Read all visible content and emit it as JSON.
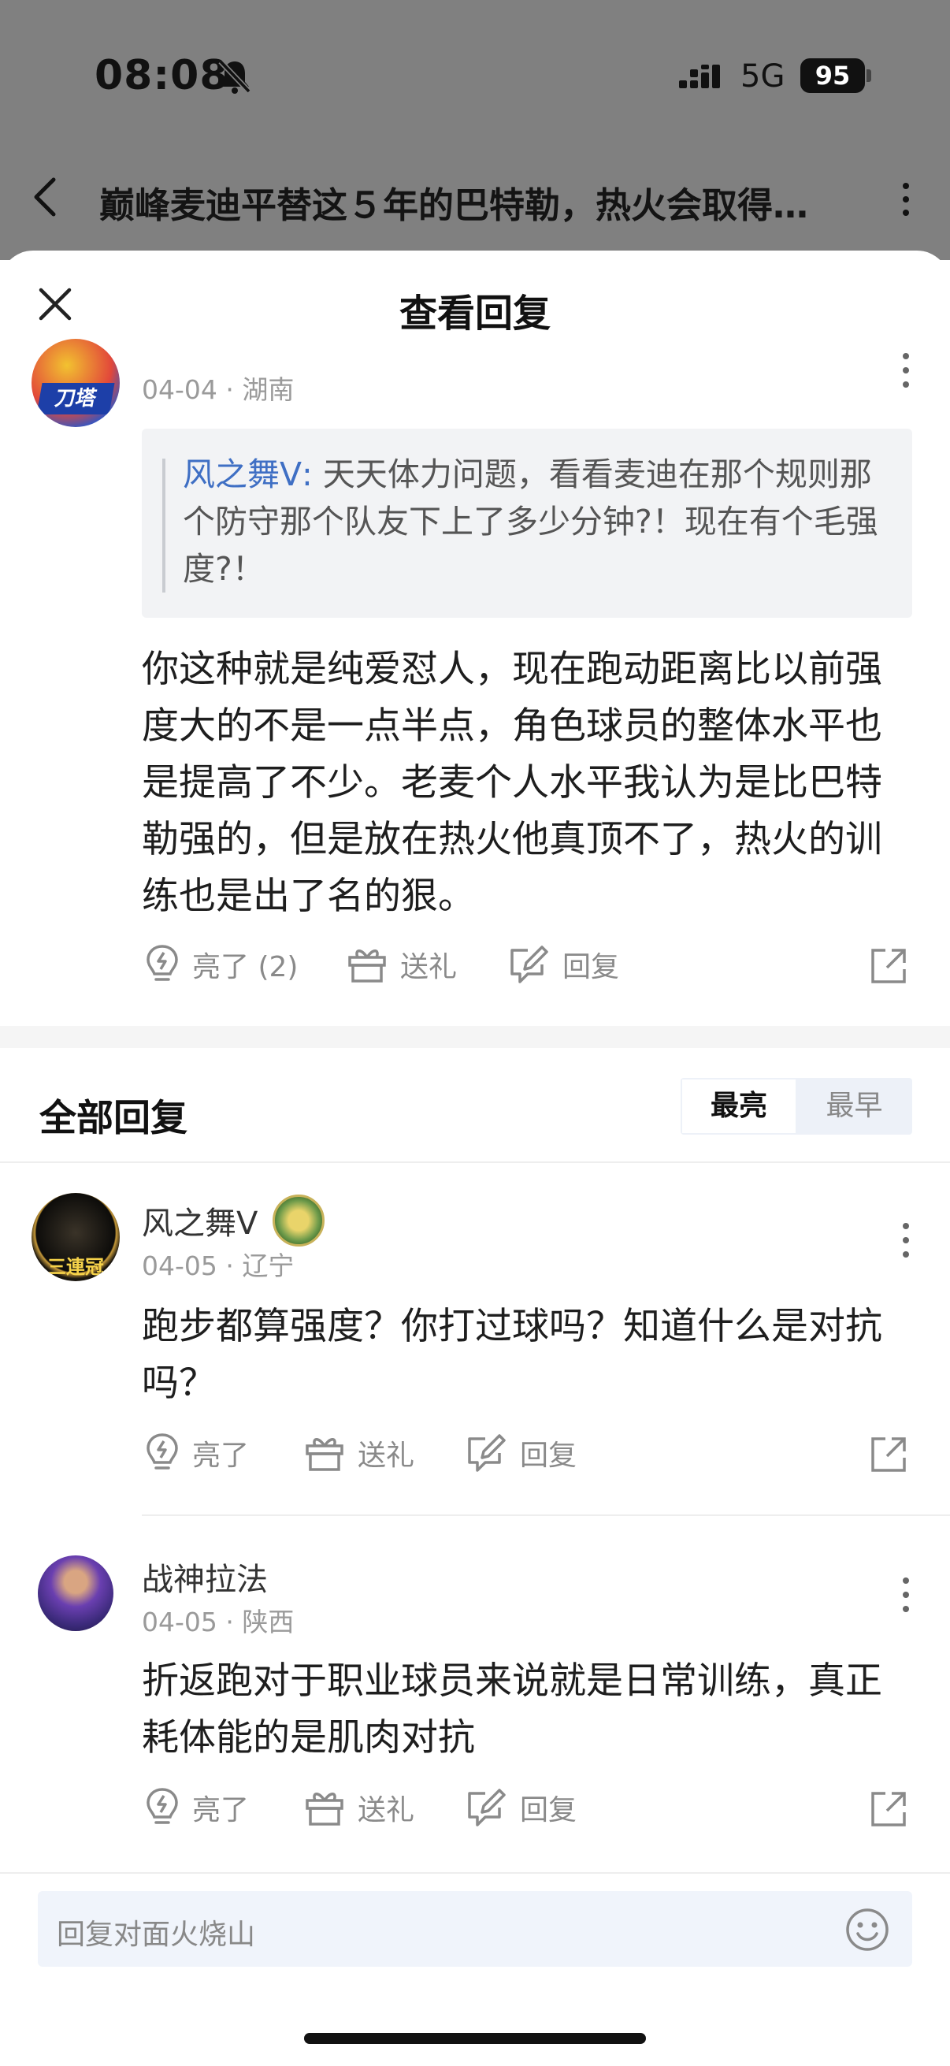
{
  "status_bar": {
    "time": "08:08",
    "network": "5G",
    "battery": "95"
  },
  "background_page": {
    "title": "巅峰麦迪平替这５年的巴特勒，热火会取得…"
  },
  "sheet": {
    "title": "查看回复"
  },
  "main_comment": {
    "date_location": "04-04 · 湖南",
    "quote_author": "风之舞Ⅴ:",
    "quote_text": " 天天体力问题，看看麦迪在那个规则那个防守那个队友下上了多少分钟?！现在有个毛强度?！",
    "text": "你这种就是纯爱怼人，现在跑动距离比以前强度大的不是一点半点，角色球员的整体水平也是提高了不少。老麦个人水平我认为是比巴特勒强的，但是放在热火他真顶不了，热火的训练也是出了名的狠。",
    "actions": {
      "like": "亮了 (2)",
      "gift": "送礼",
      "reply": "回复"
    }
  },
  "all_replies": {
    "title": "全部回复",
    "sort_options": [
      "最亮",
      "最早"
    ],
    "items": [
      {
        "name": "风之舞Ⅴ",
        "date_location": "04-05 · 辽宁",
        "text": "跑步都算强度？你打过球吗？知道什么是对抗吗？",
        "actions": {
          "like": "亮了",
          "gift": "送礼",
          "reply": "回复"
        }
      },
      {
        "name": "战神拉法",
        "date_location": "04-05 · 陕西",
        "text": "折返跑对于职业球员来说就是日常训练，真正耗体能的是肌肉对抗",
        "actions": {
          "like": "亮了",
          "gift": "送礼",
          "reply": "回复"
        }
      }
    ]
  },
  "reply_input": {
    "placeholder": "回复对面火烧山"
  },
  "colors": {
    "accent_blue": "#3f6fc4",
    "dim_overlay": "#808080",
    "input_bg": "#f0f4fb"
  },
  "icons": [
    "bell-off-icon",
    "signal-icon",
    "back-chevron-icon",
    "more-icon",
    "close-icon",
    "like-bulb-icon",
    "gift-icon",
    "reply-edit-icon",
    "share-icon",
    "emoji-icon"
  ]
}
